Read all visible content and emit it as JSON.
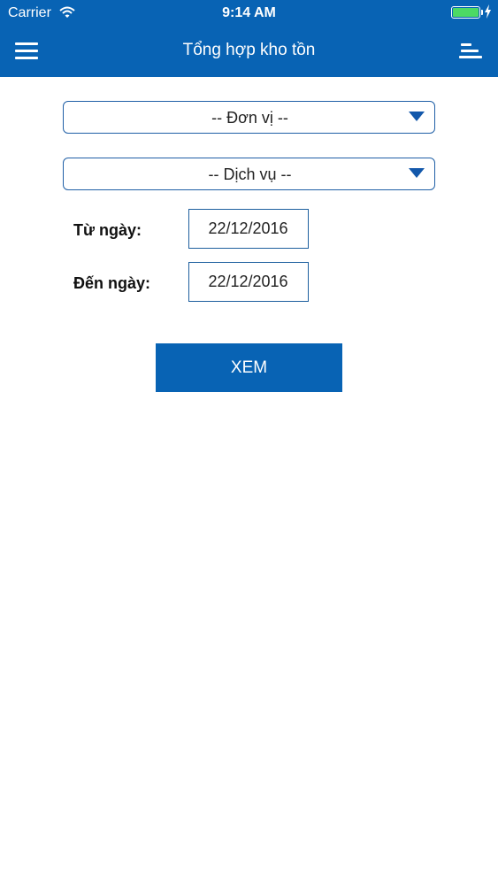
{
  "status_bar": {
    "carrier": "Carrier",
    "time": "9:14 AM",
    "battery_color": "#4cd964"
  },
  "navbar": {
    "title": "Tổng hợp kho tồn",
    "left_icon": "hamburger-menu-icon",
    "right_icon": "list-sort-icon",
    "background_color": "#0863b4"
  },
  "filters": {
    "unit_select": {
      "selected": "-- Đơn vị --"
    },
    "service_select": {
      "selected": "-- Dịch vụ --"
    },
    "from_date": {
      "label": "Từ ngày:",
      "value": "22/12/2016"
    },
    "to_date": {
      "label": "Đến ngày:",
      "value": "22/12/2016"
    }
  },
  "actions": {
    "view_label": "XEM",
    "accent_color": "#0863b4"
  }
}
